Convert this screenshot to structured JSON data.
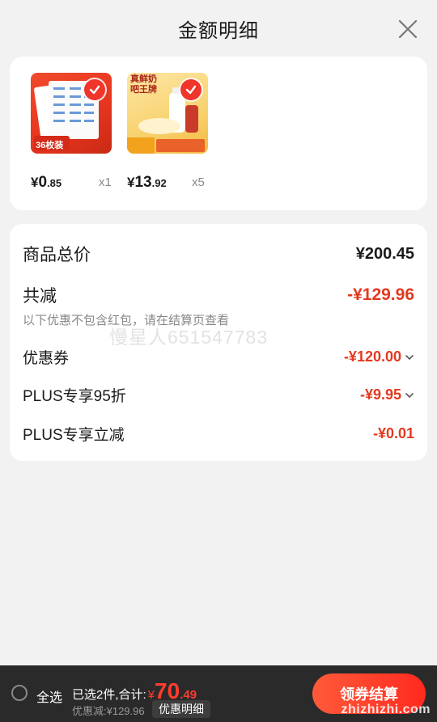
{
  "header": {
    "title": "金额明细"
  },
  "products": [
    {
      "price_yen": "¥",
      "price_int": "0",
      "price_dec": ".85",
      "qty": "x1",
      "thumb_text": "36枚装"
    },
    {
      "price_yen": "¥",
      "price_int": "13",
      "price_dec": ".92",
      "qty": "x5",
      "thumb_text": "真鲜奶吧王牌"
    }
  ],
  "summary": {
    "total_label": "商品总价",
    "total_value": "¥200.45",
    "reduce_label": "共减",
    "reduce_value": "-¥129.96",
    "note": "以下优惠不包含红包，请在结算页查看",
    "items": [
      {
        "label": "优惠券",
        "value": "-¥120.00"
      },
      {
        "label": "PLUS专享95折",
        "value": "-¥9.95"
      },
      {
        "label": "PLUS专享立减",
        "value": "-¥0.01"
      }
    ]
  },
  "watermark": "慢星人651547783",
  "bottom": {
    "select_all": "全选",
    "selected_text": "已选2件,合计:",
    "total_yen": "¥",
    "total_int": "70",
    "total_dec": ".49",
    "discount_text": "优惠减:¥129.96",
    "detail_button": "优惠明细",
    "checkout_button": "领券结算",
    "site_mark": "zhizhizhi.com"
  },
  "colors": {
    "accent_red": "#e23a1f",
    "bar_bg": "#2a2a2a",
    "check_red": "#f0352a"
  }
}
